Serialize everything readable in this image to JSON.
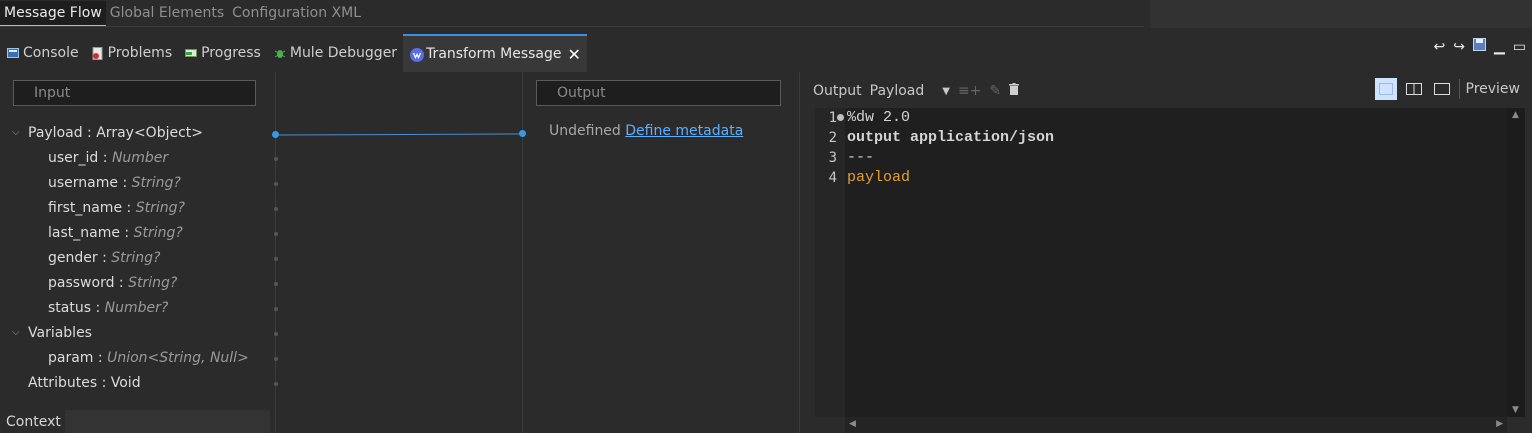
{
  "editor_tabs": [
    "Message Flow",
    "Global Elements",
    "Configuration XML"
  ],
  "view_tabs": [
    {
      "label": "Console",
      "icon": "console-icon"
    },
    {
      "label": "Problems",
      "icon": "problems-icon"
    },
    {
      "label": "Progress",
      "icon": "progress-icon"
    },
    {
      "label": "Mule Debugger",
      "icon": "bug-icon"
    },
    {
      "label": "Transform Message",
      "icon": "dataweave-icon",
      "active": true
    }
  ],
  "input_panel": {
    "search_placeholder": "Input",
    "payload": {
      "name": "Payload",
      "type": "Array<Object>"
    },
    "fields": [
      {
        "name": "user_id",
        "type": "Number"
      },
      {
        "name": "username",
        "type": "String?"
      },
      {
        "name": "first_name",
        "type": "String?"
      },
      {
        "name": "last_name",
        "type": "String?"
      },
      {
        "name": "gender",
        "type": "String?"
      },
      {
        "name": "password",
        "type": "String?"
      },
      {
        "name": "status",
        "type": "Number?"
      }
    ],
    "variables_label": "Variables",
    "variables": [
      {
        "name": "param",
        "type": "Union<String, Null>"
      }
    ],
    "attributes": {
      "name": "Attributes",
      "type": "Void"
    },
    "context_label": "Context",
    "separator": " : "
  },
  "output_panel": {
    "search_placeholder": "Output",
    "undefined_text": "Undefined",
    "define_link": "Define metadata"
  },
  "editor": {
    "output_label": "Output",
    "target": "Payload",
    "preview_label": "Preview",
    "lines": [
      {
        "num": "1",
        "text": "%dw 2.0"
      },
      {
        "num": "2",
        "text": "output application/json"
      },
      {
        "num": "3",
        "text": "---"
      },
      {
        "num": "4",
        "text": "payload"
      }
    ]
  },
  "colors": {
    "accent": "#3a8fe0",
    "mapping_dot": "#2e9bf0",
    "link": "#5cb0ff",
    "payload_keyword": "#e0a030"
  }
}
